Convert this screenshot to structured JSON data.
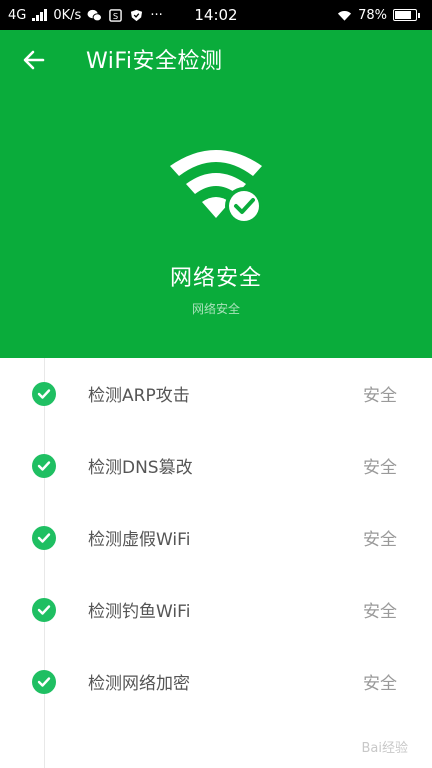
{
  "status_bar": {
    "network": "4G",
    "speed": "0K/s",
    "time": "14:02",
    "battery": "78%",
    "more": "···"
  },
  "header": {
    "title": "WiFi安全检测",
    "status_title": "网络安全",
    "status_subtitle": "网络安全",
    "background_color": "#0aac3b"
  },
  "checks": [
    {
      "label": "检测ARP攻击",
      "result": "安全"
    },
    {
      "label": "检测DNS篡改",
      "result": "安全"
    },
    {
      "label": "检测虚假WiFi",
      "result": "安全"
    },
    {
      "label": "检测钓鱼WiFi",
      "result": "安全"
    },
    {
      "label": "检测网络加密",
      "result": "安全"
    }
  ],
  "watermark": "Bai经验",
  "colors": {
    "check_green": "#1fbf62",
    "label_text": "#555555",
    "result_text": "#9a9a9a"
  }
}
